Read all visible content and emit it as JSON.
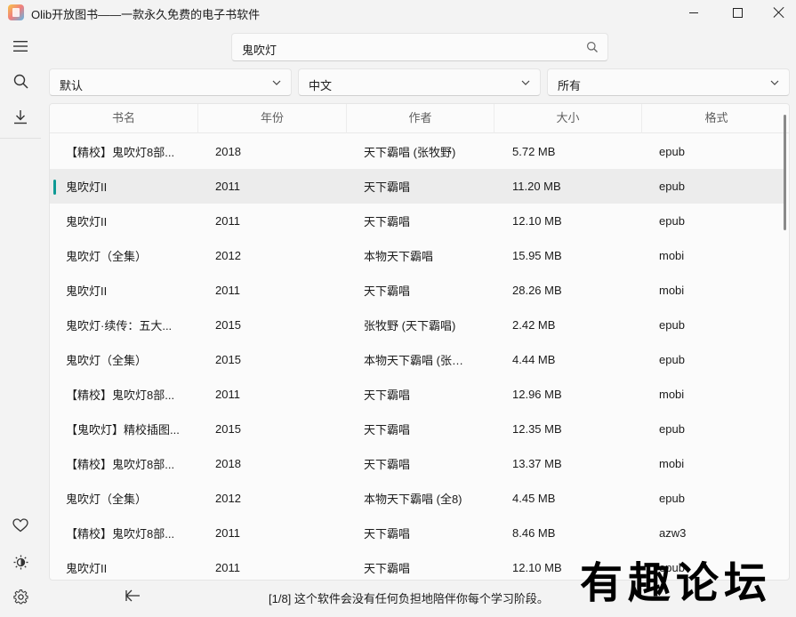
{
  "window": {
    "title": "Olib开放图书——一款永久免费的电子书软件"
  },
  "search": {
    "value": "鬼吹灯"
  },
  "filters": [
    {
      "value": "默认"
    },
    {
      "value": "中文"
    },
    {
      "value": "所有"
    }
  ],
  "table": {
    "headers": [
      "书名",
      "年份",
      "作者",
      "大小",
      "格式"
    ],
    "rows": [
      {
        "title": "【精校】鬼吹灯8部...",
        "year": "2018",
        "author": "天下霸唱 (张牧野)",
        "size": "5.72 MB",
        "format": "epub"
      },
      {
        "title": "鬼吹灯II",
        "year": "2011",
        "author": "天下霸唱",
        "size": "11.20 MB",
        "format": "epub"
      },
      {
        "title": "鬼吹灯II",
        "year": "2011",
        "author": "天下霸唱",
        "size": "12.10 MB",
        "format": "epub"
      },
      {
        "title": "鬼吹灯（全集）",
        "year": "2012",
        "author": "本物天下霸唱",
        "size": "15.95 MB",
        "format": "mobi"
      },
      {
        "title": "鬼吹灯II",
        "year": "2011",
        "author": "天下霸唱",
        "size": "28.26 MB",
        "format": "mobi"
      },
      {
        "title": "鬼吹灯·续传：五大...",
        "year": "2015",
        "author": "张牧野 (天下霸唱)",
        "size": "2.42 MB",
        "format": "epub"
      },
      {
        "title": "鬼吹灯（全集）",
        "year": "2015",
        "author": "本物天下霸唱 (张牧...",
        "size": "4.44 MB",
        "format": "epub"
      },
      {
        "title": "【精校】鬼吹灯8部...",
        "year": "2011",
        "author": "天下霸唱",
        "size": "12.96 MB",
        "format": "mobi"
      },
      {
        "title": "【鬼吹灯】精校插图...",
        "year": "2015",
        "author": "天下霸唱",
        "size": "12.35 MB",
        "format": "epub"
      },
      {
        "title": "【精校】鬼吹灯8部...",
        "year": "2018",
        "author": "天下霸唱",
        "size": "13.37 MB",
        "format": "mobi"
      },
      {
        "title": "鬼吹灯（全集）",
        "year": "2012",
        "author": "本物天下霸唱 (全8)",
        "size": "4.45 MB",
        "format": "epub"
      },
      {
        "title": "【精校】鬼吹灯8部...",
        "year": "2011",
        "author": "天下霸唱",
        "size": "8.46 MB",
        "format": "azw3"
      },
      {
        "title": "鬼吹灯II",
        "year": "2011",
        "author": "天下霸唱",
        "size": "12.10 MB",
        "format": "epub"
      }
    ]
  },
  "footer": {
    "message": "[1/8] 这个软件会没有任何负担地陪伴你每个学习阶段。"
  },
  "watermark": {
    "text": "有趣论坛"
  },
  "colors": {
    "accent": "#0f9a95",
    "selected_row": "#ececec",
    "background": "#f3f3f3"
  },
  "icons": [
    "menu-icon",
    "search-icon",
    "download-icon",
    "heart-icon",
    "brightness-icon",
    "settings-icon",
    "back-arrow-icon"
  ]
}
